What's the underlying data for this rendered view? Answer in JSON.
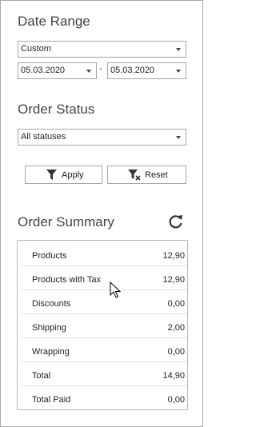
{
  "date_range": {
    "title": "Date Range",
    "preset": "Custom",
    "from": "05.03.2020",
    "separator": "-",
    "to": "05.03.2020"
  },
  "order_status": {
    "title": "Order Status",
    "selected": "All statuses"
  },
  "actions": {
    "apply_label": "Apply",
    "reset_label": "Reset"
  },
  "summary": {
    "title": "Order Summary",
    "rows": [
      {
        "label": "Products",
        "value": "12,90"
      },
      {
        "label": "Products with Tax",
        "value": "12,90"
      },
      {
        "label": "Discounts",
        "value": "0,00"
      },
      {
        "label": "Shipping",
        "value": "2,00"
      },
      {
        "label": "Wrapping",
        "value": "0,00"
      },
      {
        "label": "Total",
        "value": "14,90"
      },
      {
        "label": "Total Paid",
        "value": "0,00"
      }
    ]
  }
}
